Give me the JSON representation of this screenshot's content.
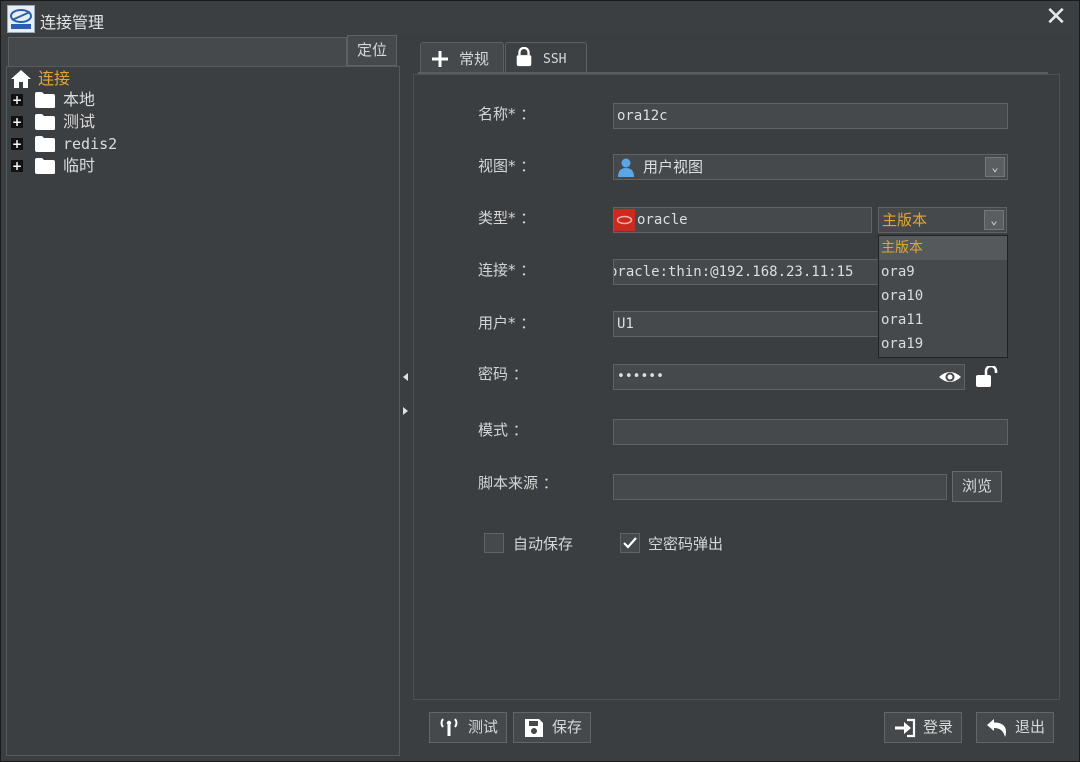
{
  "window": {
    "title": "连接管理",
    "close_glyph": "✕"
  },
  "left": {
    "search_placeholder": "",
    "locate_button": "定位",
    "tree": {
      "root": "连接",
      "items": [
        {
          "label": "本地",
          "expander": "+"
        },
        {
          "label": "测试",
          "expander": "+"
        },
        {
          "label": "redis2",
          "expander": "+"
        },
        {
          "label": "临时",
          "expander": "+"
        }
      ]
    }
  },
  "tabs": [
    {
      "label": "常规",
      "icon": "plus-icon"
    },
    {
      "label": "SSH",
      "icon": "lock-icon"
    }
  ],
  "form": {
    "name": {
      "label": "名称* ：",
      "value": "ora12c"
    },
    "view": {
      "label": "视图* ：",
      "value": "用户视图",
      "icon": "user-icon"
    },
    "type": {
      "label": "类型* ：",
      "value": "oracle",
      "icon": "oracle-icon",
      "version": "主版本"
    },
    "conn": {
      "label": "连接* ：",
      "value": "oracle:thin:@192.168.23.11:15"
    },
    "user": {
      "label": "用户* ：",
      "value": "U1"
    },
    "password": {
      "label": "密码 ：",
      "value": "••••••"
    },
    "schema": {
      "label": "模式 ：",
      "value": ""
    },
    "script": {
      "label": "脚本来源 ：",
      "value": "",
      "browse": "浏览"
    },
    "autosave": {
      "label": "自动保存",
      "checked": false
    },
    "empty_pwd_popup": {
      "label": "空密码弹出",
      "checked": true
    }
  },
  "version_options": [
    "主版本",
    "ora9",
    "ora10",
    "ora11",
    "ora19"
  ],
  "buttons": {
    "test": "测试",
    "save": "保存",
    "login": "登录",
    "exit": "退出"
  },
  "colors": {
    "accent": "#e3a531",
    "background": "#3b3e41",
    "field": "#45494c"
  }
}
